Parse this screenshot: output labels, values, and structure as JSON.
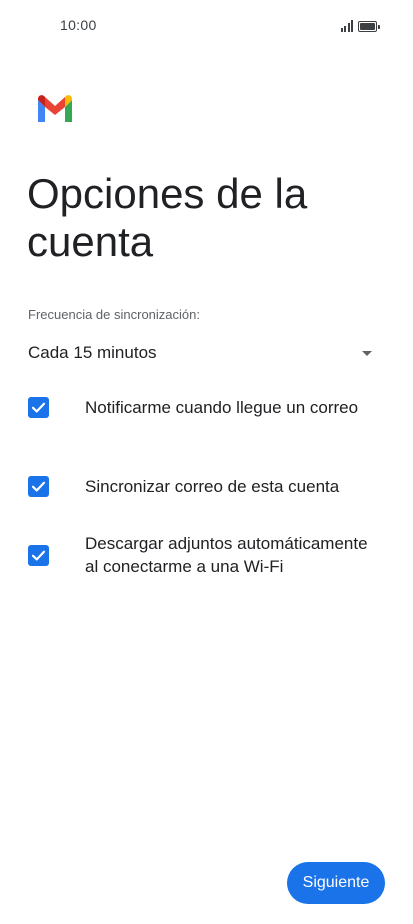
{
  "status_bar": {
    "time": "10:00",
    "icons": [
      "signal-icon",
      "battery-icon"
    ]
  },
  "header": {
    "logo": "gmail-logo",
    "title": "Opciones de la cuenta"
  },
  "sync": {
    "label": "Frecuencia de sincronización:",
    "selected": "Cada 15 minutos"
  },
  "options": [
    {
      "label": "Notificarme cuando llegue un correo",
      "checked": true
    },
    {
      "label": "Sincronizar correo de esta cuenta",
      "checked": true
    },
    {
      "label": "Descargar adjuntos automáticamente al conectarme a una Wi-Fi",
      "checked": true
    }
  ],
  "footer": {
    "next_label": "Siguiente"
  },
  "colors": {
    "accent": "#1a73e8",
    "text": "#202124",
    "secondary_text": "#5f6368",
    "background": "#ffffff"
  }
}
